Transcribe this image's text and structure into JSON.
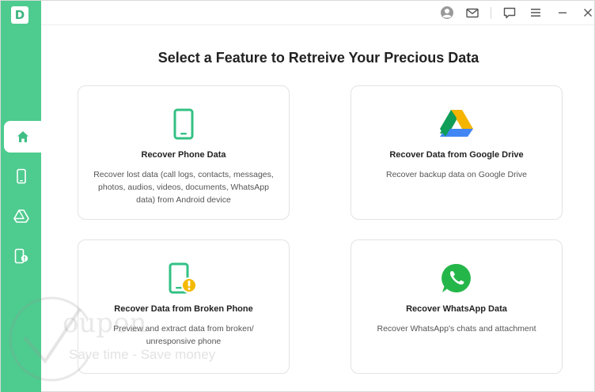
{
  "app": {
    "logo_letter": "D"
  },
  "sidebar": {
    "items": [
      {
        "name": "home",
        "icon": "home-icon",
        "active": true
      },
      {
        "name": "phone",
        "icon": "phone-icon",
        "active": false
      },
      {
        "name": "google-drive",
        "icon": "google-drive-icon",
        "active": false
      },
      {
        "name": "broken-phone",
        "icon": "broken-phone-icon",
        "active": false
      }
    ]
  },
  "topbar": {
    "icons": [
      "user-icon",
      "mail-icon",
      "feedback-icon",
      "menu-icon",
      "minimize-icon",
      "close-icon"
    ]
  },
  "main": {
    "title": "Select a Feature to Retreive Your Precious Data",
    "cards": [
      {
        "icon": "phone-icon",
        "title": "Recover Phone Data",
        "description": "Recover lost data (call logs, contacts, messages, photos, audios, videos, documents, WhatsApp data) from Android device"
      },
      {
        "icon": "google-drive-icon",
        "title": "Recover Data from Google Drive",
        "description": "Recover backup data on Google Drive"
      },
      {
        "icon": "broken-phone-icon",
        "title": "Recover Data from Broken Phone",
        "description": "Preview and extract data from broken/ unresponsive phone"
      },
      {
        "icon": "whatsapp-icon",
        "title": "Recover WhatsApp Data",
        "description": "Recover WhatsApp's chats and attachment"
      }
    ]
  },
  "watermark": {
    "word": "oupon",
    "tagline": "Save time - Save money"
  },
  "colors": {
    "accent": "#4ecb8f",
    "accent_dark": "#2fb877",
    "whatsapp": "#25b64a",
    "warning": "#f5b800"
  }
}
